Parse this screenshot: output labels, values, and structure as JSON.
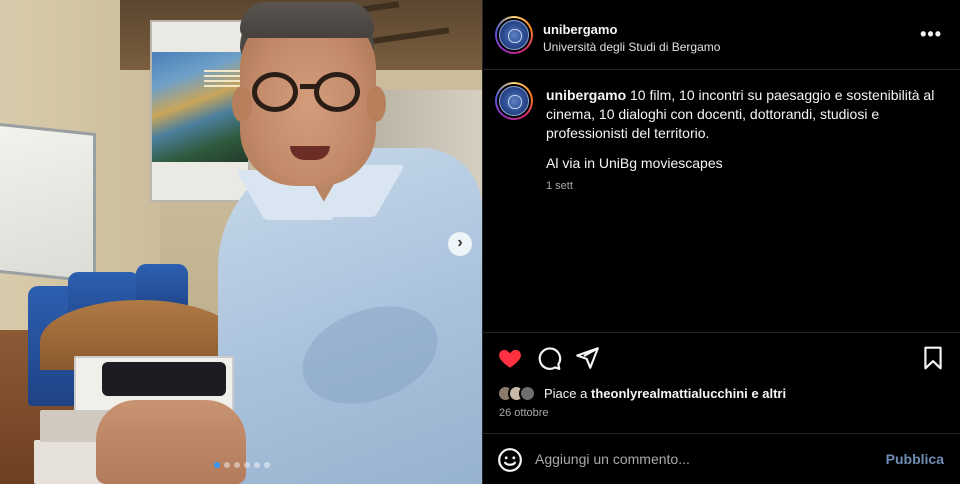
{
  "post": {
    "carousel_dots": 6,
    "active_dot": 0
  },
  "header": {
    "username": "unibergamo",
    "subtitle": "Università degli Studi di Bergamo",
    "more_icon": "more-options-icon"
  },
  "caption": {
    "username": "unibergamo",
    "text": "10 film, 10 incontri su paesaggio e sostenibilità al cinema, 10 dialoghi con docenti, dottorandi, studiosi e professionisti del territorio.",
    "line2": "Al via in UniBg moviescapes",
    "time": "1 sett"
  },
  "actions": {
    "like_icon": "heart-filled-icon",
    "comment_icon": "comment-icon",
    "share_icon": "share-icon",
    "save_icon": "bookmark-icon",
    "like_color": "#ff3040"
  },
  "likes": {
    "prefix": "Piace a",
    "user": "theonlyrealmattialucchini",
    "suffix": "e altri"
  },
  "date": "26 ottobre",
  "comment": {
    "placeholder": "Aggiungi un commento...",
    "publish": "Pubblica",
    "emoji_icon": "emoji-icon"
  }
}
